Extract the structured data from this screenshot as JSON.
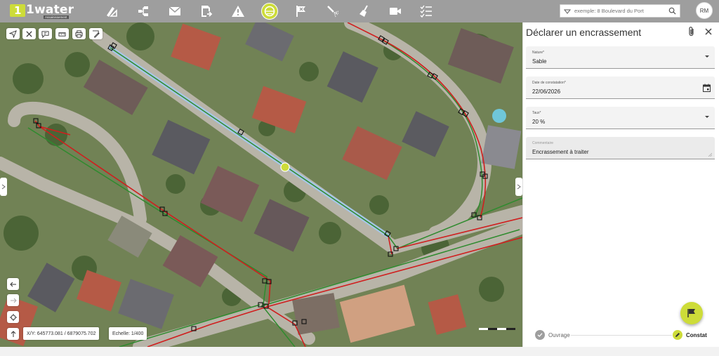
{
  "app": {
    "logo_text": "1water",
    "logo_tagline": "Assainissement"
  },
  "topnav": {
    "icons": [
      "pencil-ruler-icon",
      "network-icon",
      "envelope-icon",
      "report-arrow-icon",
      "warning-icon",
      "inspection-icon",
      "flag-icon",
      "hydrant-flush-icon",
      "cleaning-icon",
      "camera-icon",
      "checklist-icon"
    ],
    "active": "inspection-icon"
  },
  "search": {
    "placeholder": "exemple: 8 Boulevard du Port"
  },
  "user": {
    "initials": "RM"
  },
  "map": {
    "coords_label": "X/Y: 645773.081 / 6879075.702",
    "scale_label": "Echelle: 1/400",
    "tools": [
      "locate-icon",
      "clear-icon",
      "comment-icon",
      "measure-icon",
      "print-icon",
      "draw-icon"
    ],
    "nav": [
      "back-icon",
      "forward-icon",
      "crosshair-icon",
      "north-arrow-icon"
    ]
  },
  "panel": {
    "title": "Déclarer un encrassement",
    "fields": {
      "nature": {
        "label": "Nature*",
        "value": "Sable"
      },
      "date": {
        "label": "Date de constatation*",
        "value": "22/06/2026"
      },
      "taux": {
        "label": "Taux*",
        "value": "20 %"
      },
      "commentaire": {
        "label": "Commentaire",
        "value": "Encrassement à traiter"
      }
    },
    "steps": [
      {
        "label": "Ouvrage",
        "state": "done"
      },
      {
        "label": "Constat",
        "state": "active"
      }
    ]
  },
  "colors": {
    "accent": "#cddc39",
    "topbar": "#9e9e9e",
    "pipe_red": "#d32f2f",
    "pipe_green": "#2e7d32",
    "selected_pipe": "#9ec3e6"
  }
}
